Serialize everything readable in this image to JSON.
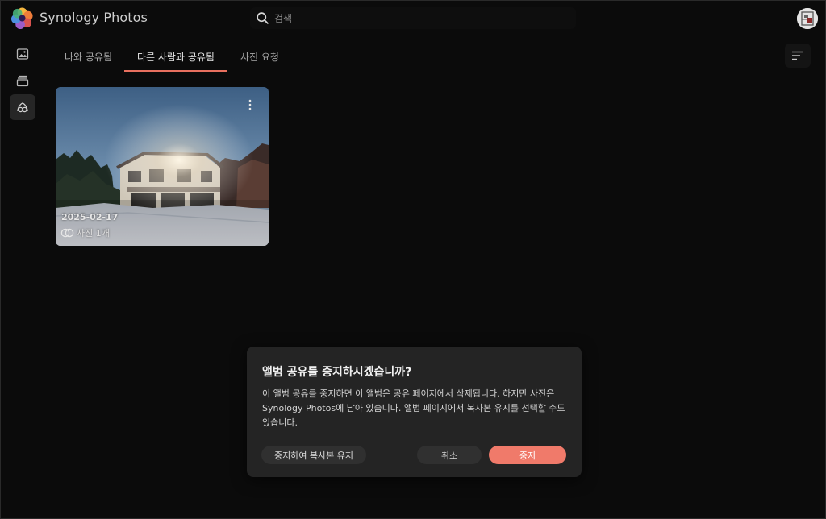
{
  "app": {
    "title": "Synology Photos"
  },
  "header": {
    "search": {
      "value": "",
      "placeholder": "검색",
      "icon": "search-icon"
    },
    "avatar_icon": "user-avatar"
  },
  "sidebar": {
    "items": [
      {
        "icon": "photo-icon",
        "active": false
      },
      {
        "icon": "albums-icon",
        "active": false
      },
      {
        "icon": "shared-icon",
        "active": true
      }
    ]
  },
  "tabs": [
    {
      "label": "나와 공유됨",
      "active": false
    },
    {
      "label": "다른 사람과 공유됨",
      "active": true
    },
    {
      "label": "사진 요청",
      "active": false
    }
  ],
  "toolbar": {
    "sort_icon": "sort-icon"
  },
  "albums": [
    {
      "date": "2025-02-17",
      "count_label": "사진 1개",
      "shared_icon": "linked-circles-icon",
      "more_icon": "more-vertical-icon"
    }
  ],
  "dialog": {
    "title": "앨범 공유를 중지하시겠습니까?",
    "body": "이 앨범 공유를 중지하면 이 앨범은 공유 페이지에서 삭제됩니다. 하지만 사진은 Synology Photos에 남아 있습니다. 앨범 페이지에서 복사본 유지를 선택할 수도 있습니다.",
    "keep_copy_label": "중지하여 복사본 유지",
    "cancel_label": "취소",
    "stop_label": "중지"
  },
  "colors": {
    "accent": "#e8705f",
    "stop_button": "#f07a6a",
    "background": "#0b0b0b",
    "dialog_background": "#242424"
  }
}
